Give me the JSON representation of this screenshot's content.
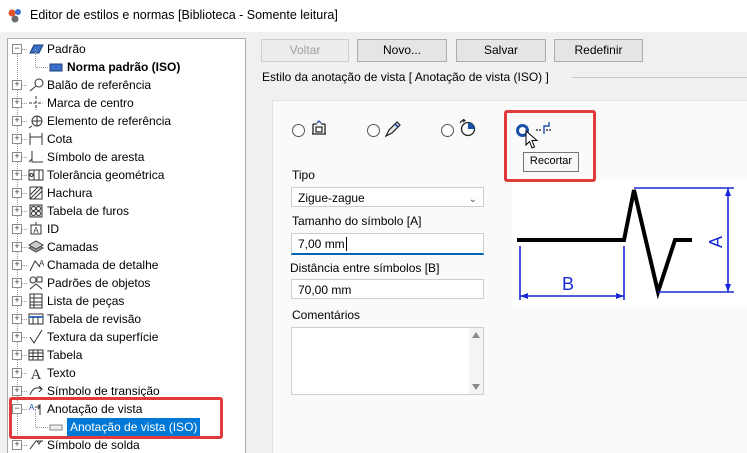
{
  "window": {
    "title": "Editor de estilos e normas [Biblioteca - Somente leitura]"
  },
  "tree": {
    "items": [
      {
        "label": "Padrão",
        "level": 0,
        "expander": "−",
        "icon": "standard-icon"
      },
      {
        "label": "Norma padrão (ISO)",
        "level": 1,
        "bold": true,
        "icon": "standard-child-icon"
      },
      {
        "label": "Balão de referência",
        "level": 0,
        "expander": "+",
        "icon": "balloon-icon"
      },
      {
        "label": "Marca de centro",
        "level": 0,
        "expander": "+",
        "icon": "center-mark-icon"
      },
      {
        "label": "Elemento de referência",
        "level": 0,
        "expander": "+",
        "icon": "datum-target-icon"
      },
      {
        "label": "Cota",
        "level": 0,
        "expander": "+",
        "icon": "dimension-icon"
      },
      {
        "label": "Símbolo de aresta",
        "level": 0,
        "expander": "+",
        "icon": "edge-symbol-icon"
      },
      {
        "label": "Tolerância geométrica",
        "level": 0,
        "expander": "+",
        "icon": "feature-control-frame-icon"
      },
      {
        "label": "Hachura",
        "level": 0,
        "expander": "+",
        "icon": "hatch-icon"
      },
      {
        "label": "Tabela de furos",
        "level": 0,
        "expander": "+",
        "icon": "hole-table-icon"
      },
      {
        "label": "ID",
        "level": 0,
        "expander": "+",
        "icon": "id-icon"
      },
      {
        "label": "Camadas",
        "level": 0,
        "expander": "+",
        "icon": "layers-icon"
      },
      {
        "label": "Chamada de detalhe",
        "level": 0,
        "expander": "+",
        "icon": "leader-icon"
      },
      {
        "label": "Padrões de objetos",
        "level": 0,
        "expander": "+",
        "icon": "object-defaults-icon"
      },
      {
        "label": "Lista de peças",
        "level": 0,
        "expander": "+",
        "icon": "parts-list-icon"
      },
      {
        "label": "Tabela de revisão",
        "level": 0,
        "expander": "+",
        "icon": "revision-table-icon"
      },
      {
        "label": "Textura da superfície",
        "level": 0,
        "expander": "+",
        "icon": "surface-texture-icon"
      },
      {
        "label": "Tabela",
        "level": 0,
        "expander": "+",
        "icon": "table-icon"
      },
      {
        "label": "Texto",
        "level": 0,
        "expander": "+",
        "icon": "text-icon"
      },
      {
        "label": "Símbolo de transição",
        "level": 0,
        "expander": "+",
        "icon": "transition-symbol-icon"
      },
      {
        "label": "Anotação de vista",
        "level": 0,
        "expander": "−",
        "icon": "view-annotation-icon"
      },
      {
        "label": "Anotação de vista (ISO)",
        "level": 1,
        "selected": true,
        "icon": "view-annotation-style-icon"
      },
      {
        "label": "Símbolo de solda",
        "level": 0,
        "expander": "+",
        "icon": "weld-symbol-icon"
      }
    ]
  },
  "toolbar": {
    "back": "Voltar",
    "new": "Novo...",
    "save": "Salvar",
    "reset": "Redefinir"
  },
  "section": {
    "title": "Estilo da anotação de vista [ Anotação de vista (ISO) ]"
  },
  "options": {
    "radios": [
      {
        "name": "view-option-1",
        "icon": "section-view-icon",
        "selected": false
      },
      {
        "name": "view-option-2",
        "icon": "detail-view-icon",
        "selected": false
      },
      {
        "name": "view-option-3",
        "icon": "rotate-view-icon",
        "selected": false
      },
      {
        "name": "view-option-break",
        "icon": "break-view-icon",
        "selected": true
      }
    ],
    "tooltip": "Recortar"
  },
  "form": {
    "tipo_label": "Tipo",
    "tipo_value": "Zigue-zague",
    "tamanho_label": "Tamanho do símbolo [A]",
    "tamanho_value": "7,00 mm",
    "distancia_label": "Distância entre símbolos [B]",
    "distancia_value": "70,00 mm",
    "comentarios_label": "Comentários",
    "comentarios_value": ""
  },
  "preview": {
    "label_a": "A",
    "label_b": "B"
  },
  "colors": {
    "accent": "#0078d7",
    "highlight": "#e03a3a",
    "dimension": "#1a2bd6"
  }
}
